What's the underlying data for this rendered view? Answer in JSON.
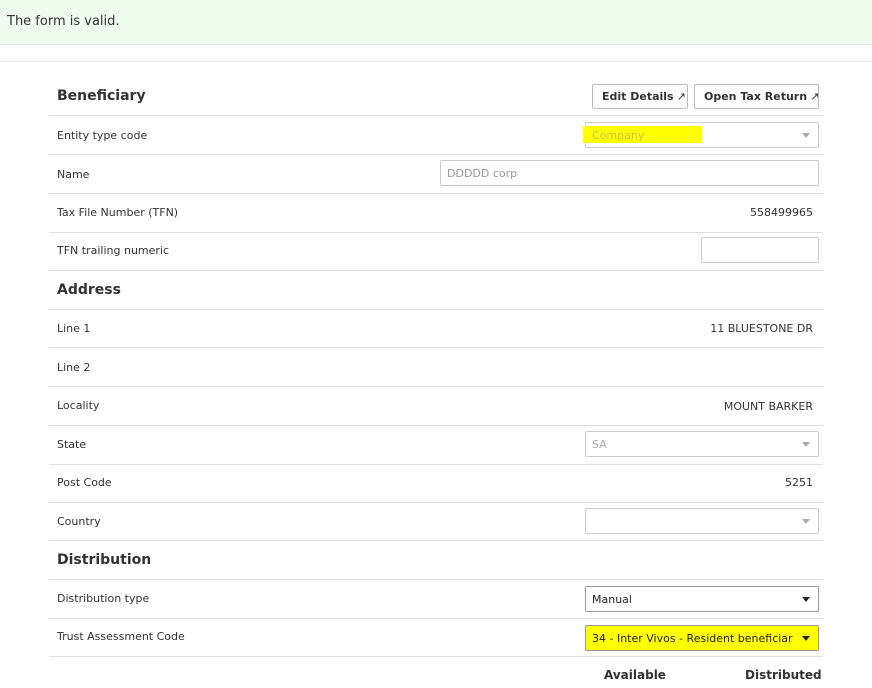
{
  "banner": {
    "message": "The form is valid."
  },
  "beneficiary": {
    "title": "Beneficiary",
    "edit_details_label": "Edit Details",
    "open_tax_return_label": "Open Tax Return",
    "entity_type_label": "Entity type code",
    "entity_type_value": "Company",
    "name_label": "Name",
    "name_placeholder": "DDDDD corp",
    "tfn_label": "Tax File Number (TFN)",
    "tfn_value": "558499965",
    "tfn_trailing_label": "TFN trailing numeric",
    "tfn_trailing_value": ""
  },
  "address": {
    "title": "Address",
    "line1_label": "Line 1",
    "line1_value": "11 BLUESTONE DR",
    "line2_label": "Line 2",
    "line2_value": "",
    "locality_label": "Locality",
    "locality_value": "MOUNT BARKER",
    "state_label": "State",
    "state_value": "SA",
    "postcode_label": "Post Code",
    "postcode_value": "5251",
    "country_label": "Country",
    "country_value": ""
  },
  "distribution": {
    "title": "Distribution",
    "type_label": "Distribution type",
    "type_value": "Manual",
    "trust_code_label": "Trust Assessment Code",
    "trust_code_value": "34 - Inter Vivos - Resident beneficiar",
    "col_available": "Available",
    "col_distributed": "Distributed"
  },
  "icons": {
    "external_link": "external-link-icon",
    "dropdown": "chevron-down-icon"
  },
  "colors": {
    "banner_bg": "#eefdee",
    "highlight": "#ffff00"
  }
}
